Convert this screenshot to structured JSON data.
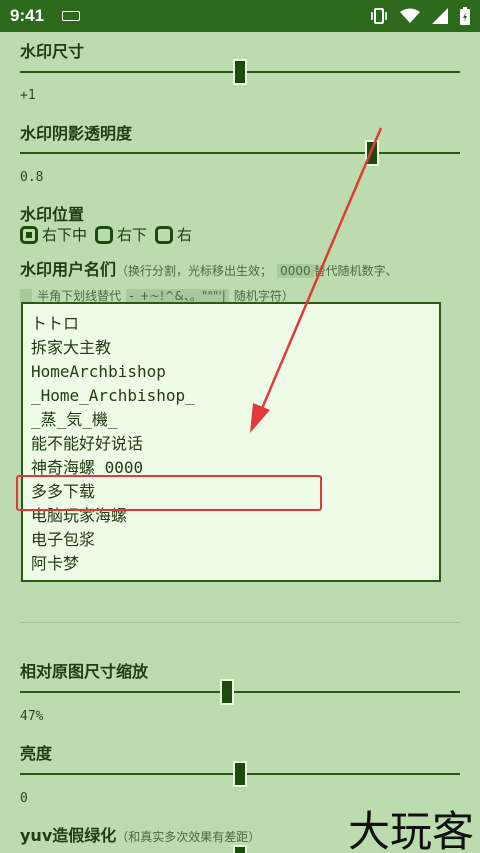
{
  "status": {
    "time": "9:41"
  },
  "watermark_size": {
    "label": "水印尺寸",
    "value": "+1",
    "level": 0.5
  },
  "shadow_opacity": {
    "label": "水印阴影透明度",
    "value": "0.8",
    "level": 0.8
  },
  "position": {
    "label": "水印位置",
    "options": [
      {
        "label": "右下中",
        "checked": true
      },
      {
        "label": "右下",
        "checked": false
      },
      {
        "label": "右",
        "checked": false
      }
    ]
  },
  "usernames": {
    "label": "水印用户名们",
    "hint_open": "（换行分割，光标移出生效；",
    "chip1": "0000",
    "hint_mid": "替代随机数字、",
    "chip2": "_",
    "hint_mid2": "半角下划线替代",
    "chip3": "-_+~!^&、。\"\"\"'|",
    "hint_close": "随机字符）",
    "lines": [
      "トトロ",
      "拆家大主教",
      "HomeArchbishop",
      "_Home_Archbishop_",
      "_蒸_気_機_",
      "能不能好好说话",
      "神奇海螺 0000",
      "多多下载",
      "电脑玩家海螺",
      "电子包浆",
      "阿卡梦"
    ]
  },
  "scale": {
    "label": "相对原图尺寸缩放",
    "value": "47%",
    "level": 0.47
  },
  "brightness": {
    "label": "亮度",
    "value": "0",
    "level": 0.5
  },
  "yuv": {
    "label": "yuv造假绿化",
    "hint": "（和真实多次效果有差距）",
    "level": 0.5
  },
  "corner_watermark": "大玩客"
}
